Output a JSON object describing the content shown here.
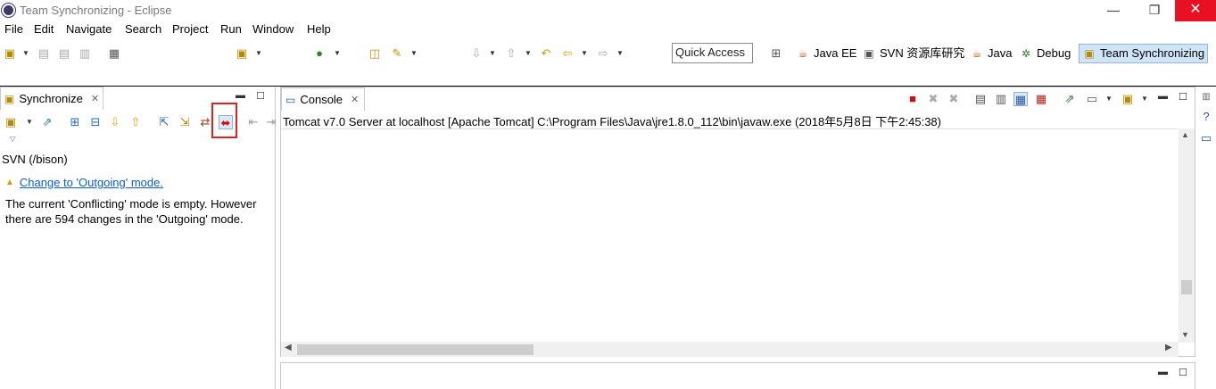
{
  "window": {
    "title": "Team Synchronizing - Eclipse",
    "minimize_glyph": "—",
    "restore_glyph": "❐",
    "close_glyph": "✕"
  },
  "menubar": [
    "File",
    "Edit",
    "Navigate",
    "Search",
    "Project",
    "Run",
    "Window",
    "Help"
  ],
  "toolbar": {
    "quick_access_label": "Quick Access",
    "perspectives": [
      {
        "label": "Java EE",
        "icon": "java-ee-perspective-icon"
      },
      {
        "label": "SVN 资源库研究",
        "icon": "svn-perspective-icon"
      },
      {
        "label": "Java",
        "icon": "java-perspective-icon"
      },
      {
        "label": "Debug",
        "icon": "debug-perspective-icon"
      },
      {
        "label": "Team Synchronizing",
        "icon": "team-sync-perspective-icon",
        "active": true
      }
    ]
  },
  "synchronize_view": {
    "tab_label": "Synchronize",
    "repository_label": "SVN (/bison)",
    "link_text": "Change to 'Outgoing' mode.",
    "message": "The current 'Conflicting' mode is empty. However there are 594 changes in the 'Outgoing' mode."
  },
  "console_view": {
    "tab_label": "Console",
    "process_text": "Tomcat v7.0 Server at localhost [Apache Tomcat] C:\\Program Files\\Java\\jre1.8.0_112\\bin\\javaw.exe (2018年5月8日 下午2:45:38)"
  },
  "colors": {
    "accent_blue": "#0b5ec9",
    "close_red": "#e81123",
    "highlight_red": "#e02020",
    "active_perspective_bg": "#cfe4f7"
  }
}
